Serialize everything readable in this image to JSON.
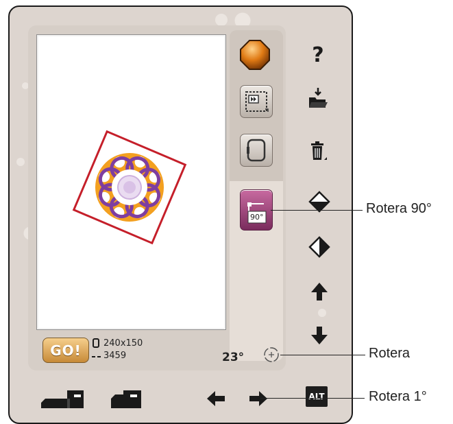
{
  "toolbar_right": {
    "help": "?",
    "icons": [
      "help-icon",
      "load-icon",
      "delete-icon",
      "mirror-vertical-icon",
      "mirror-horizontal-icon",
      "move-up-icon",
      "move-down-icon"
    ]
  },
  "side_buttons": {
    "rotate90_label": "90°"
  },
  "status": {
    "go_label": "GO!",
    "hoop_size": "240x150",
    "stitch_count": "3459",
    "angle": "23°"
  },
  "bottom_bar": {
    "alt_label": "ALT"
  },
  "callouts": {
    "rotera90": "Rotera 90°",
    "rotera": "Rotera",
    "rotera1": "Rotera 1°"
  },
  "colors": {
    "embroidery_purple": "#7e3ea0",
    "embroidery_orange": "#f3a020",
    "hoop_red": "#c51f2a",
    "go_button": "#e0a857"
  }
}
